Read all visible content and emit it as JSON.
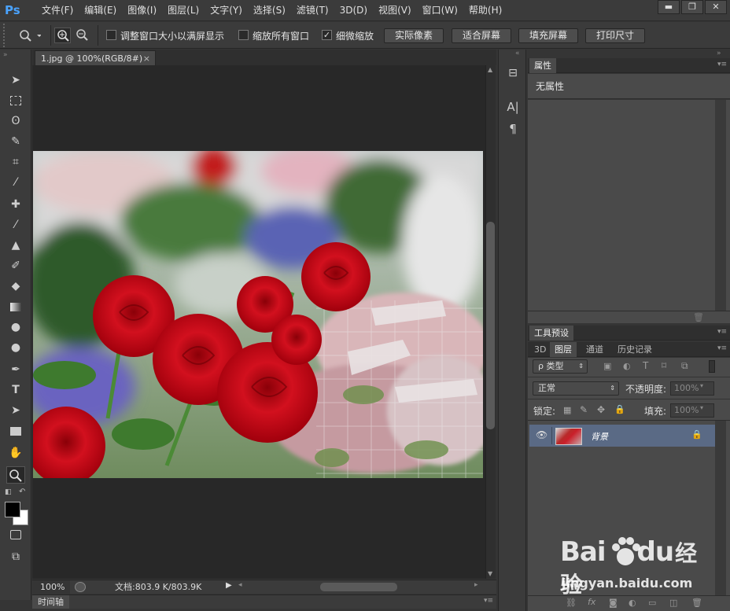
{
  "app": {
    "logo": "Ps"
  },
  "menu": [
    "文件(F)",
    "编辑(E)",
    "图像(I)",
    "图层(L)",
    "文字(Y)",
    "选择(S)",
    "滤镜(T)",
    "3D(D)",
    "视图(V)",
    "窗口(W)",
    "帮助(H)"
  ],
  "window_controls": {
    "minimize": "▬",
    "maximize": "❐",
    "close": "✕"
  },
  "options": {
    "resize_windows_label": "调整窗口大小以满屏显示",
    "zoom_all_label": "缩放所有窗口",
    "scrubby_zoom_label": "细微缩放",
    "actual_pixels": "实际像素",
    "fit_screen": "适合屏幕",
    "fill_screen": "填充屏幕",
    "print_size": "打印尺寸"
  },
  "document": {
    "tab_title": "1.jpg @ 100%(RGB/8#)",
    "tab_close": "×"
  },
  "status": {
    "zoom": "100%",
    "doc_info": "文档:803.9 K/803.9K"
  },
  "timeline_label": "时间轴",
  "properties": {
    "tab": "属性",
    "message": "无属性"
  },
  "tool_presets_tab": "工具预设",
  "layer_tabs": [
    "3D",
    "图层",
    "通道",
    "历史记录"
  ],
  "layers": {
    "filter_kind": "ρ 类型",
    "blend_mode": "正常",
    "opacity_label": "不透明度:",
    "opacity_value": "100%",
    "lock_label": "锁定:",
    "fill_label": "填充:",
    "fill_value": "100%",
    "layer_name": "背景"
  },
  "watermark": {
    "brand": "Bai",
    "brand2": "du",
    "brand_cn": "经验",
    "url": "jingyan.baidu.com"
  },
  "colors": {
    "accent": "#4aa3ff",
    "selected_layer": "#5a6a85",
    "bg": "#353535"
  }
}
